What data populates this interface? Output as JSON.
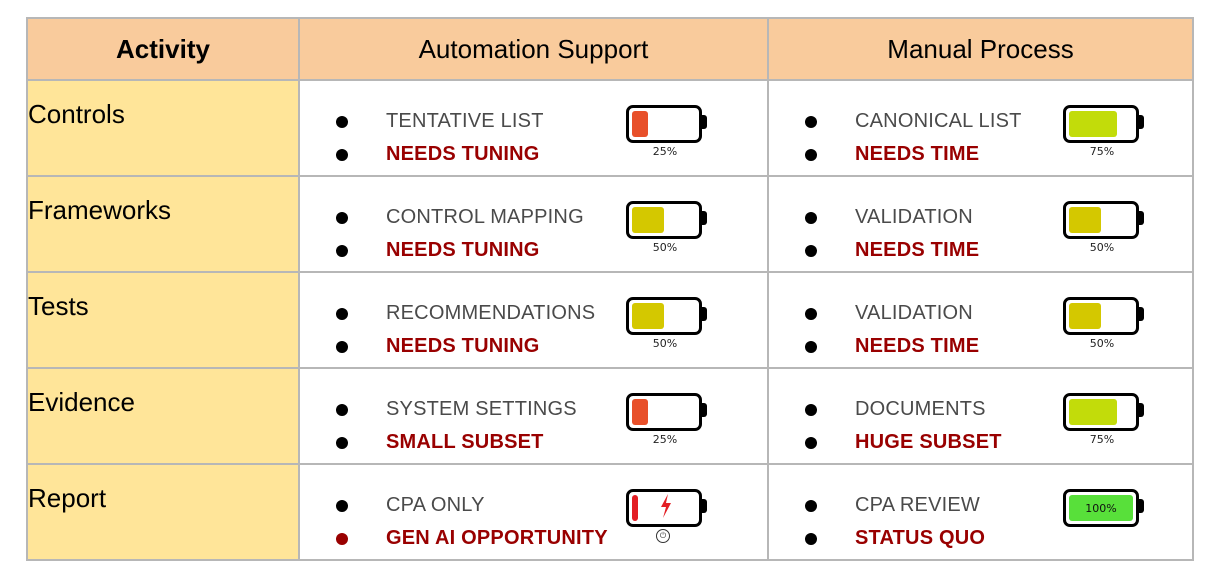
{
  "header": {
    "activity": "Activity",
    "automation": "Automation Support",
    "manual": "Manual Process"
  },
  "colors": {
    "header_bg": "#f9cb9c",
    "activity_bg": "#ffe599",
    "emphasis_text": "#990000",
    "battery_25": "#e8502a",
    "battery_50": "#d4c800",
    "battery_75": "#c2dc0a",
    "battery_100": "#58e03a",
    "battery_charging": "#e31e24"
  },
  "rows": [
    {
      "activity": "Controls",
      "automation": {
        "line1": "TENTATIVE LIST",
        "line2": "NEEDS TUNING",
        "battery_percent": 25,
        "battery_label": "25%"
      },
      "manual": {
        "line1": "CANONICAL LIST",
        "line2": "NEEDS TIME",
        "battery_percent": 75,
        "battery_label": "75%"
      }
    },
    {
      "activity": "Frameworks",
      "automation": {
        "line1": "CONTROL MAPPING",
        "line2": "NEEDS TUNING",
        "battery_percent": 50,
        "battery_label": "50%"
      },
      "manual": {
        "line1": "VALIDATION",
        "line2": "NEEDS TIME",
        "battery_percent": 50,
        "battery_label": "50%"
      }
    },
    {
      "activity": "Tests",
      "automation": {
        "line1": "RECOMMENDATIONS",
        "line2": "NEEDS TUNING",
        "battery_percent": 50,
        "battery_label": "50%"
      },
      "manual": {
        "line1": "VALIDATION",
        "line2": "NEEDS TIME",
        "battery_percent": 50,
        "battery_label": "50%"
      }
    },
    {
      "activity": "Evidence",
      "automation": {
        "line1": "SYSTEM SETTINGS",
        "line2": "SMALL SUBSET",
        "battery_percent": 25,
        "battery_label": "25%"
      },
      "manual": {
        "line1": "DOCUMENTS",
        "line2": "HUGE SUBSET",
        "battery_percent": 75,
        "battery_label": "75%"
      }
    },
    {
      "activity": "Report",
      "automation": {
        "line1": "CPA ONLY",
        "line2": "GEN AI OPPORTUNITY",
        "battery_percent": 10,
        "battery_label": "",
        "charging": true,
        "charging_icon": "lightning-bolt",
        "plug_icon": "plug"
      },
      "manual": {
        "line1": "CPA REVIEW",
        "line2": "STATUS QUO",
        "battery_percent": 100,
        "battery_label": "100%"
      }
    }
  ]
}
